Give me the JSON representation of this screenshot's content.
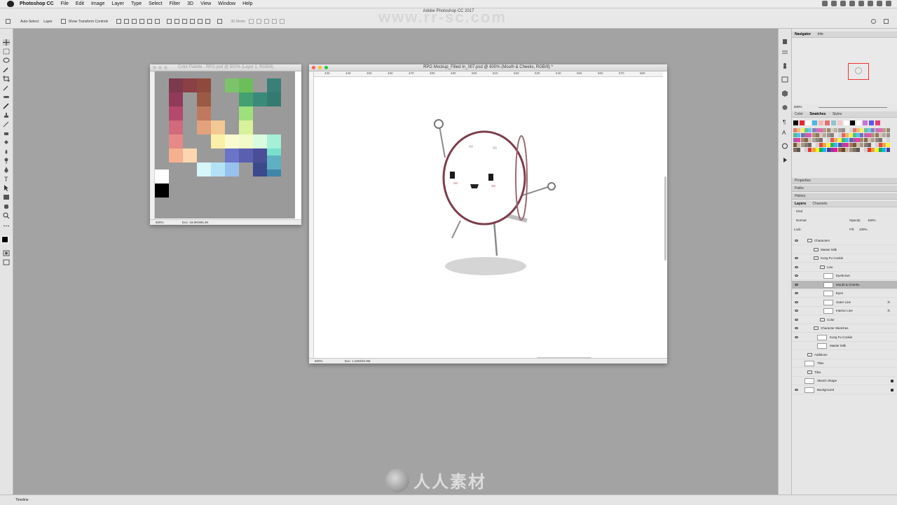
{
  "menubar": {
    "app": "Photoshop CC",
    "items": [
      "File",
      "Edit",
      "Image",
      "Layer",
      "Type",
      "Select",
      "Filter",
      "3D",
      "View",
      "Window",
      "Help"
    ]
  },
  "app_title": "Adobe Photoshop CC 2017",
  "watermark_url": "www.rr-sc.com",
  "watermark_logo_text": "人人素材",
  "options_bar": {
    "auto_select_label": "Auto-Select:",
    "auto_select_value": "Layer",
    "show_transform": "Show Transform Controls",
    "mode_3d": "3D Mode:"
  },
  "doc_palette": {
    "title": "Color Palette - RPG.psd @ 500% (Layer 1, RGB/8)",
    "zoom": "500%",
    "doc_info": "Doc: 18.8K/806.3K",
    "swatches": [
      {
        "col": 1,
        "row": 1,
        "color": "#7c3a4f"
      },
      {
        "col": 2,
        "row": 1,
        "color": "#8a4045"
      },
      {
        "col": 3,
        "row": 1,
        "color": "#8f4a3d"
      },
      {
        "col": 1,
        "row": 2,
        "color": "#913a5a"
      },
      {
        "col": 3,
        "row": 2,
        "color": "#9b5a45"
      },
      {
        "col": 1,
        "row": 3,
        "color": "#b34a6d"
      },
      {
        "col": 3,
        "row": 3,
        "color": "#c0785e"
      },
      {
        "col": 1,
        "row": 4,
        "color": "#d06a7c"
      },
      {
        "col": 3,
        "row": 4,
        "color": "#e2a27d"
      },
      {
        "col": 4,
        "row": 4,
        "color": "#f2c894"
      },
      {
        "col": 1,
        "row": 5,
        "color": "#e58a88"
      },
      {
        "col": 4,
        "row": 5,
        "color": "#fbf0a8"
      },
      {
        "col": 5,
        "row": 5,
        "color": "#fbfbd0"
      },
      {
        "col": 1,
        "row": 6,
        "color": "#f6b090"
      },
      {
        "col": 2,
        "row": 6,
        "color": "#fbd6b0"
      },
      {
        "col": 5,
        "row": 1,
        "color": "#7cc46a"
      },
      {
        "col": 6,
        "row": 1,
        "color": "#6cbe5a"
      },
      {
        "col": 8,
        "row": 1,
        "color": "#3a7f78"
      },
      {
        "col": 6,
        "row": 2,
        "color": "#43a06f"
      },
      {
        "col": 7,
        "row": 2,
        "color": "#3a8a7a"
      },
      {
        "col": 8,
        "row": 2,
        "color": "#347a70"
      },
      {
        "col": 6,
        "row": 3,
        "color": "#9ee07a"
      },
      {
        "col": 6,
        "row": 4,
        "color": "#d8f29a"
      },
      {
        "col": 6,
        "row": 5,
        "color": "#f2fac8"
      },
      {
        "col": 7,
        "row": 5,
        "color": "#d9fbe0"
      },
      {
        "col": 8,
        "row": 5,
        "color": "#a6f0d8"
      },
      {
        "col": 8,
        "row": 6,
        "color": "#7ae0cc"
      },
      {
        "col": 3,
        "row": 7,
        "color": "#d6f6fa"
      },
      {
        "col": 4,
        "row": 7,
        "color": "#b2e2f4"
      },
      {
        "col": 5,
        "row": 7,
        "color": "#98c2ee"
      },
      {
        "col": 5,
        "row": 6,
        "color": "#6b74c6"
      },
      {
        "col": 6,
        "row": 6,
        "color": "#5a5fb0"
      },
      {
        "col": 7,
        "row": 6,
        "color": "#4a4e96"
      },
      {
        "col": 7,
        "row": 7,
        "color": "#3a4a8a"
      },
      {
        "col": 8,
        "row": 7,
        "color": "#3f86a8"
      },
      {
        "col": 8,
        "row": 6.5,
        "color": "#5fb0c2"
      },
      {
        "col": 0,
        "row": 7,
        "color": "#ffffff"
      },
      {
        "col": 0,
        "row": 8,
        "color": "#000000"
      }
    ]
  },
  "doc_main": {
    "title": "RPG Mockup_Filled In_007.psd @ 600% (Mouth & Cheeks, RGB/8) *",
    "zoom": "600%",
    "doc_info": "Doc: 1.02M/40.9M",
    "ruler_ticks": [
      "430",
      "440",
      "450",
      "460",
      "470",
      "480",
      "490",
      "500",
      "510",
      "520",
      "530",
      "540",
      "550",
      "560",
      "570",
      "580"
    ]
  },
  "panels": {
    "top_tabs": [
      "Navigator",
      "Info"
    ],
    "navigator_zoom": "600%",
    "color_tabs": [
      "Color",
      "Swatches",
      "Styles"
    ],
    "collapsed": [
      "Properties",
      "Paths",
      "History"
    ],
    "layers_tabs": [
      "Layers",
      "Channels"
    ],
    "kind_label": "Kind",
    "blend_mode": "Normal",
    "opacity_label": "Opacity:",
    "opacity_value": "100%",
    "lock_label": "Lock:",
    "fill_label": "Fill:",
    "fill_value": "100%"
  },
  "layers": [
    {
      "name": "Characters",
      "indent": 0,
      "type": "group",
      "eye": true
    },
    {
      "name": "Master Milk",
      "indent": 1,
      "type": "group",
      "eye": false
    },
    {
      "name": "Kung Fu Cookie",
      "indent": 1,
      "type": "group",
      "eye": true
    },
    {
      "name": "Line",
      "indent": 2,
      "type": "group",
      "eye": true
    },
    {
      "name": "Eyebrows",
      "indent": 3,
      "type": "layer",
      "eye": true
    },
    {
      "name": "Mouth & Cheeks",
      "indent": 3,
      "type": "layer",
      "eye": true,
      "selected": true
    },
    {
      "name": "Eyes",
      "indent": 3,
      "type": "layer",
      "eye": true
    },
    {
      "name": "Outer Line",
      "indent": 3,
      "type": "layer",
      "eye": true,
      "fx": true
    },
    {
      "name": "Interior Line",
      "indent": 3,
      "type": "layer",
      "eye": true,
      "fx": true
    },
    {
      "name": "Color",
      "indent": 2,
      "type": "group",
      "eye": true
    },
    {
      "name": "Character Sketches",
      "indent": 1,
      "type": "group",
      "eye": true
    },
    {
      "name": "Kung Fu Cookie",
      "indent": 2,
      "type": "layer",
      "eye": true
    },
    {
      "name": "Master Milk",
      "indent": 2,
      "type": "layer",
      "eye": false
    },
    {
      "name": "Additions",
      "indent": 0,
      "type": "group",
      "eye": false
    },
    {
      "name": "Tiles",
      "indent": 0,
      "type": "layer",
      "eye": false
    },
    {
      "name": "Tiles",
      "indent": 0,
      "type": "group",
      "eye": false
    },
    {
      "name": "Sketch Shape",
      "indent": 0,
      "type": "layer",
      "eye": false,
      "lock": true
    },
    {
      "name": "Background",
      "indent": 0,
      "type": "layer",
      "eye": true,
      "lock": true
    }
  ],
  "timeline_label": "Timeline",
  "swatch_row1": [
    "#000000",
    "#e8262d",
    "#ffffff",
    "#4fb4e6",
    "#f2b7b0",
    "#e76e6e",
    "#8fc4d0",
    "#f5c6c6",
    "#ffffff",
    "#000000",
    "#ffffff",
    "#c774d8",
    "#5a5ae0",
    "#e83a7a"
  ],
  "swatch_grid_colors": [
    "#e2231a",
    "#f7941d",
    "#fff200",
    "#00a651",
    "#00aeef",
    "#2e3192",
    "#92278f",
    "#ec008c",
    "#8c6239",
    "#603913",
    "#c7b299",
    "#998675",
    "#736357",
    "#534741",
    "#e6e6e6",
    "#cccccc"
  ]
}
